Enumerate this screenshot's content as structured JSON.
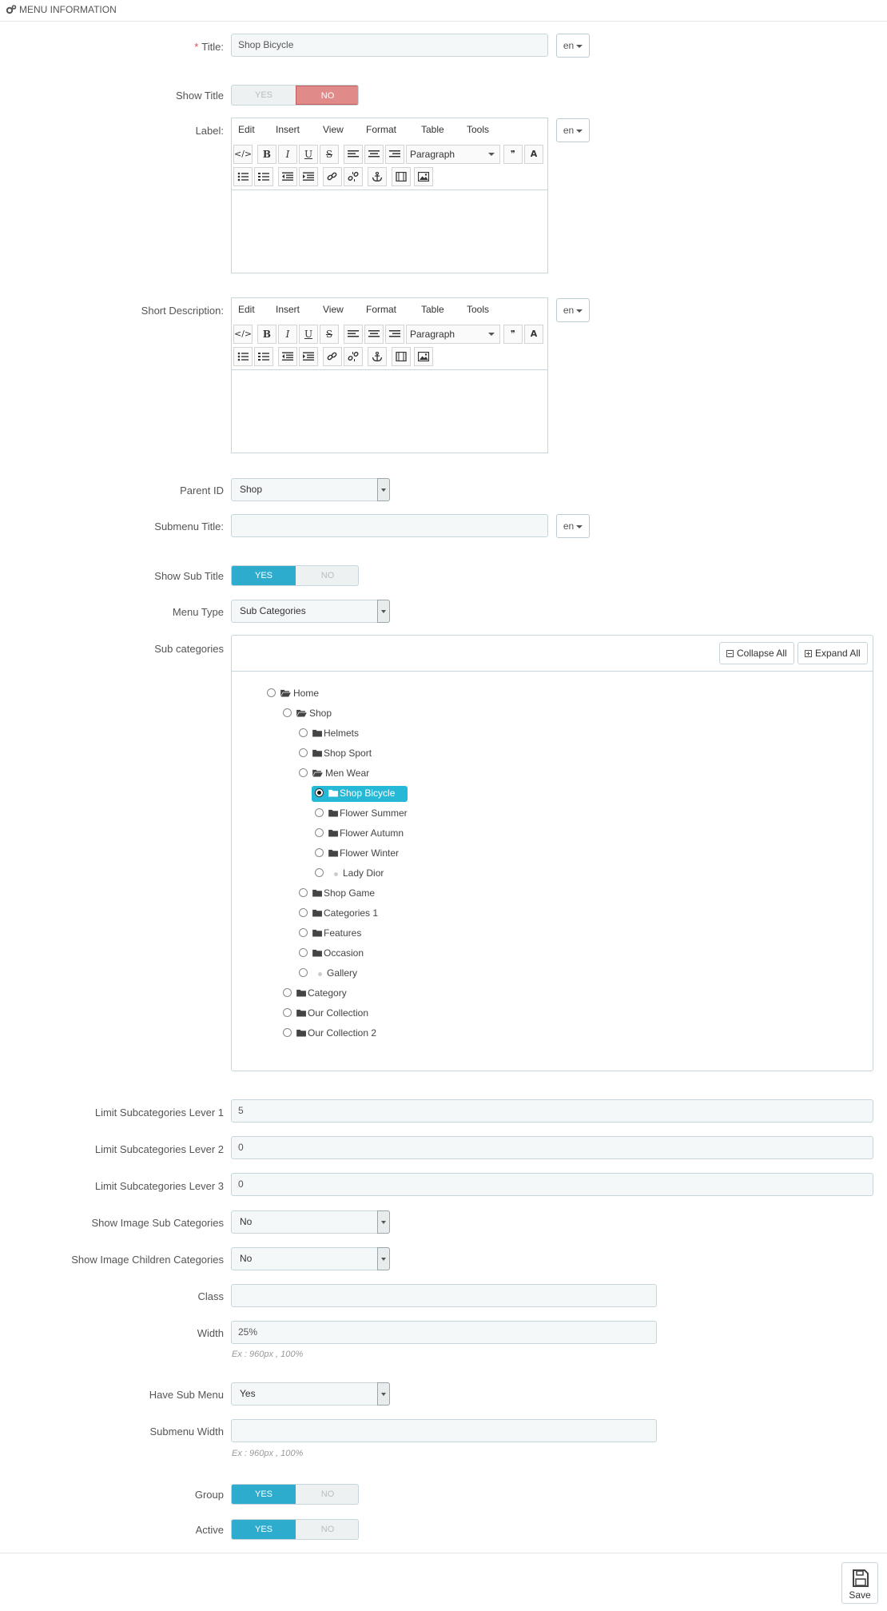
{
  "panel": {
    "title": "Menu information",
    "icon": "gears-icon"
  },
  "fields": {
    "title": {
      "label": "Title:",
      "required_mark": "*",
      "value": "Shop Bicycle",
      "lang": "en"
    },
    "show_title": {
      "label": "Show Title",
      "yes": "YES",
      "no": "NO",
      "selected": "NO"
    },
    "label": {
      "label": "Label:",
      "lang": "en"
    },
    "short_description": {
      "label": "Short Description:",
      "lang": "en"
    },
    "parent_id": {
      "label": "Parent ID",
      "value": "Shop"
    },
    "submenu_title": {
      "label": "Submenu Title:",
      "value": "",
      "lang": "en"
    },
    "show_sub_title": {
      "label": "Show Sub Title",
      "yes": "YES",
      "no": "NO",
      "selected": "YES"
    },
    "menu_type": {
      "label": "Menu Type",
      "value": "Sub Categories"
    },
    "sub_categories": {
      "label": "Sub categories",
      "collapse_all": "Collapse All",
      "expand_all": "Expand All"
    },
    "limit1": {
      "label": "Limit Subcategories Lever 1",
      "value": "5"
    },
    "limit2": {
      "label": "Limit Subcategories Lever 2",
      "value": "0"
    },
    "limit3": {
      "label": "Limit Subcategories Lever 3",
      "value": "0"
    },
    "show_image_sub": {
      "label": "Show Image Sub Categories",
      "value": "No"
    },
    "show_image_children": {
      "label": "Show Image Children Categories",
      "value": "No"
    },
    "class": {
      "label": "Class",
      "value": ""
    },
    "width": {
      "label": "Width",
      "value": "25%",
      "hint": "Ex : 960px , 100%"
    },
    "have_sub_menu": {
      "label": "Have Sub Menu",
      "value": "Yes"
    },
    "submenu_width": {
      "label": "Submenu Width",
      "value": "",
      "hint": "Ex : 960px , 100%"
    },
    "group": {
      "label": "Group",
      "yes": "YES",
      "no": "NO",
      "selected": "YES"
    },
    "active": {
      "label": "Active",
      "yes": "YES",
      "no": "NO",
      "selected": "YES"
    }
  },
  "editor": {
    "menus": [
      "Edit",
      "Insert",
      "View",
      "Format",
      "Table",
      "Tools"
    ],
    "format_select": "Paragraph",
    "row1_icons": [
      "source-code-icon",
      "bold-icon",
      "italic-icon",
      "underline-icon",
      "strikethrough-icon",
      "align-left-icon",
      "align-center-icon",
      "align-right-icon",
      "format-select",
      "blockquote-icon",
      "text-color-icon"
    ],
    "row1_glyphs": [
      "</>",
      "B",
      "I",
      "U",
      "S",
      "",
      "",
      "",
      "",
      "❞",
      "A"
    ],
    "row2_icons": [
      "bullet-list-icon",
      "numbered-list-icon",
      "outdent-icon",
      "indent-icon",
      "link-icon",
      "unlink-icon",
      "anchor-icon",
      "media-icon",
      "image-icon"
    ]
  },
  "tree": [
    {
      "label": "Home",
      "depth": 0,
      "icon": "folder-open-icon"
    },
    {
      "label": "Shop",
      "depth": 1,
      "icon": "folder-open-icon"
    },
    {
      "label": "Helmets",
      "depth": 2,
      "icon": "folder-icon"
    },
    {
      "label": "Shop Sport",
      "depth": 2,
      "icon": "folder-icon"
    },
    {
      "label": "Men Wear",
      "depth": 2,
      "icon": "folder-open-icon"
    },
    {
      "label": "Shop Bicycle",
      "depth": 3,
      "icon": "folder-icon",
      "selected": true
    },
    {
      "label": "Flower Summer",
      "depth": 3,
      "icon": "folder-icon"
    },
    {
      "label": "Flower Autumn",
      "depth": 3,
      "icon": "folder-icon"
    },
    {
      "label": "Flower Winter",
      "depth": 3,
      "icon": "folder-icon"
    },
    {
      "label": "Lady Dior",
      "depth": 3,
      "icon": "leaf-dot-icon"
    },
    {
      "label": "Shop Game",
      "depth": 2,
      "icon": "folder-icon"
    },
    {
      "label": "Categories 1",
      "depth": 2,
      "icon": "folder-icon"
    },
    {
      "label": "Features",
      "depth": 2,
      "icon": "folder-icon"
    },
    {
      "label": "Occasion",
      "depth": 2,
      "icon": "folder-icon"
    },
    {
      "label": "Gallery",
      "depth": 2,
      "icon": "leaf-dot-icon"
    },
    {
      "label": "Category",
      "depth": 1,
      "icon": "folder-icon"
    },
    {
      "label": "Our Collection",
      "depth": 1,
      "icon": "folder-icon"
    },
    {
      "label": "Our Collection 2",
      "depth": 1,
      "icon": "folder-icon"
    }
  ],
  "footer": {
    "save_label": "Save"
  },
  "colors": {
    "switch_yes": "#2eacce",
    "switch_no": "#e08a8a",
    "tree_selected": "#25b9d7"
  }
}
